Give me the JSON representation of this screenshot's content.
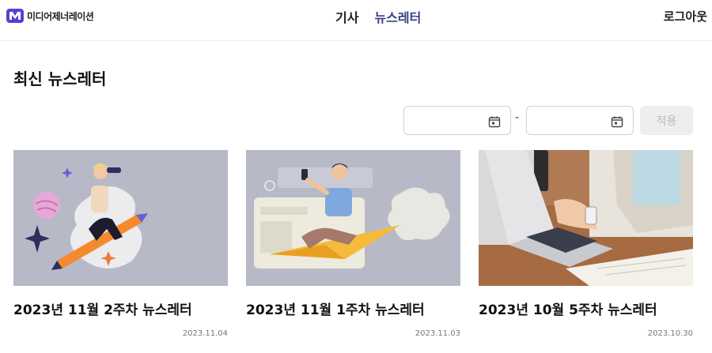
{
  "header": {
    "logo_text": "미디어제너레이션",
    "nav": [
      {
        "label": "기사",
        "active": false
      },
      {
        "label": "뉴스레터",
        "active": true
      }
    ],
    "logout_label": "로그아웃"
  },
  "page": {
    "title": "최신 뉴스레터"
  },
  "filter": {
    "start_value": "",
    "end_value": "",
    "separator": "-",
    "apply_label": "적용"
  },
  "cards": [
    {
      "title": "2023년 11월 2주차 뉴스레터",
      "date": "2023.11.04"
    },
    {
      "title": "2023년 11월 1주차 뉴스레터",
      "date": "2023.11.03"
    },
    {
      "title": "2023년 10월 5주차 뉴스레터",
      "date": "2023.10.30"
    }
  ],
  "colors": {
    "accent": "#3a3f86",
    "logo": "#5b3fd3",
    "thumb_bg": "#b8b9c7"
  }
}
